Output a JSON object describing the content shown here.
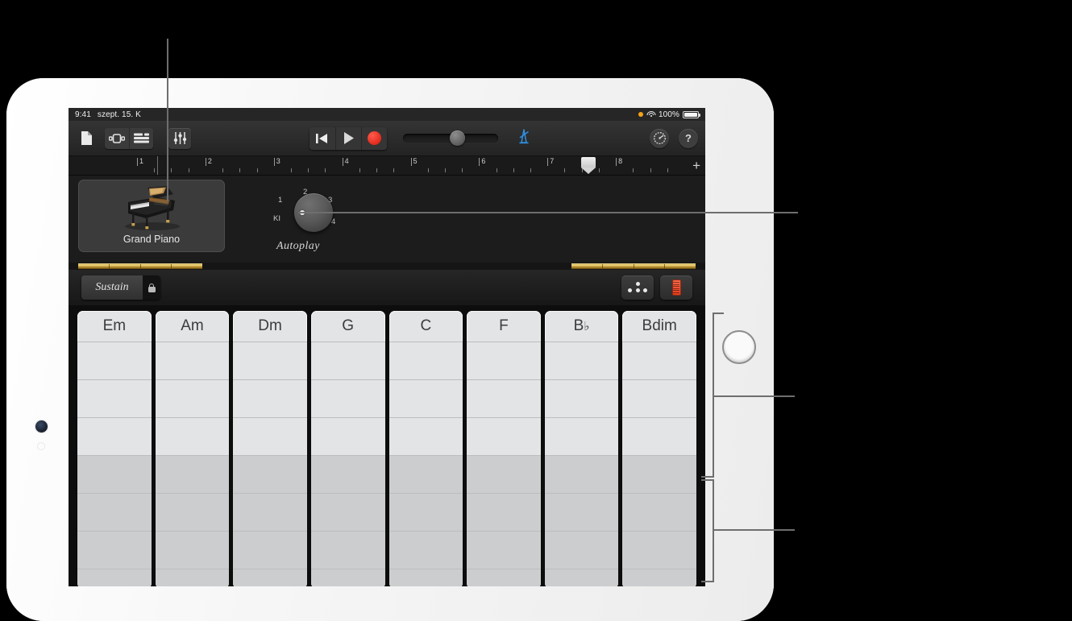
{
  "statusbar": {
    "time": "9:41",
    "date": "szept. 15. K",
    "battery_percent": "100%",
    "orange_dot_color": "#f4a317"
  },
  "toolbar": {
    "browser_label": "",
    "icons": [
      {
        "name": "my-songs-icon",
        "glyph": "document"
      },
      {
        "name": "instrument-view-icon",
        "glyph": "instrument"
      },
      {
        "name": "tracks-view-icon",
        "glyph": "tracks"
      },
      {
        "name": "mixer-icon",
        "glyph": "faders"
      }
    ],
    "transport": [
      {
        "name": "rewind-button",
        "glyph": "rewind"
      },
      {
        "name": "play-button",
        "glyph": "play"
      },
      {
        "name": "record-button",
        "glyph": "record"
      }
    ],
    "volume_slider": {
      "name": "master-volume-slider",
      "value_pct": 50
    },
    "metronome": {
      "name": "metronome-button",
      "color": "#2e8fe0",
      "active": true
    },
    "settings": {
      "name": "settings-button",
      "glyph": "gear"
    },
    "help": {
      "name": "help-button",
      "glyph": "?"
    }
  },
  "ruler": {
    "bars": [
      "1",
      "2",
      "3",
      "4",
      "5",
      "6",
      "7",
      "8"
    ],
    "add_button": "+",
    "playhead_bar": 7.6
  },
  "instrument": {
    "name": "Grand Piano",
    "autoplay": {
      "title": "Autoplay",
      "positions": [
        "KI",
        "1",
        "2",
        "3",
        "4"
      ],
      "selected": "KI"
    }
  },
  "controls": {
    "sustain_label": "Sustain",
    "lock_icon": "lock-icon",
    "chords_button": "chord-dots-icon",
    "notes_button": "fader-icon"
  },
  "chords": {
    "strips": [
      {
        "name": "Em",
        "root": "Em"
      },
      {
        "name": "Am",
        "root": "Am"
      },
      {
        "name": "Dm",
        "root": "Dm"
      },
      {
        "name": "G",
        "root": "G"
      },
      {
        "name": "C",
        "root": "C"
      },
      {
        "name": "F",
        "root": "F"
      },
      {
        "name": "B",
        "root": "B",
        "accidental": "♭"
      },
      {
        "name": "Bdim",
        "root": "Bdim"
      }
    ]
  },
  "annotations": {
    "instrument_callout": "",
    "autoplay_callout": "",
    "upper_region_callout": "",
    "lower_region_callout": ""
  },
  "colors": {
    "screen_bg": "#0d0d0d",
    "toolbar_bg": "#2b2b2b",
    "chord_face": "#e3e4e6",
    "chord_face_lower": "#cccdcf",
    "gold": "#c8a03c",
    "record_red": "#e22b1c",
    "metronome_blue": "#2e8fe0"
  }
}
